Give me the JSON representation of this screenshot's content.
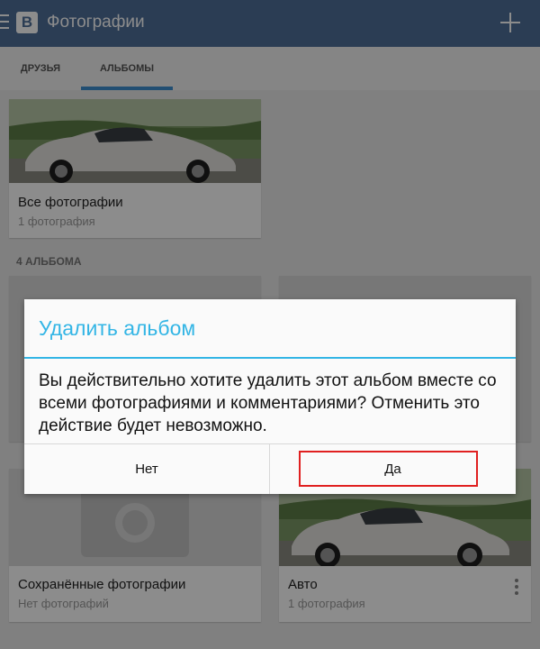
{
  "app": {
    "logo_letter": "В",
    "title": "Фотографии"
  },
  "tabs": [
    {
      "label": "ДРУЗЬЯ"
    },
    {
      "label": "АЛЬБОМЫ"
    }
  ],
  "all_photos": {
    "title": "Все фотографии",
    "count": "1 фотография"
  },
  "section": {
    "label": "4 АЛЬБОМА"
  },
  "albums": [
    {
      "title": "Сохранённые фотографии",
      "count": "Нет фотографий"
    },
    {
      "title": "Авто",
      "count": "1 фотография"
    }
  ],
  "dialog": {
    "title": "Удалить альбом",
    "message": "Вы действительно хотите удалить этот альбом вместе со всеми фотографиями и комментариями? Отменить это действие будет невозможно.",
    "no_label": "Нет",
    "yes_label": "Да"
  },
  "colors": {
    "appbar": "#4f6f9a",
    "accent": "#33b5e5",
    "tab_indicator": "#3d8ed0",
    "highlight": "#e02020"
  }
}
